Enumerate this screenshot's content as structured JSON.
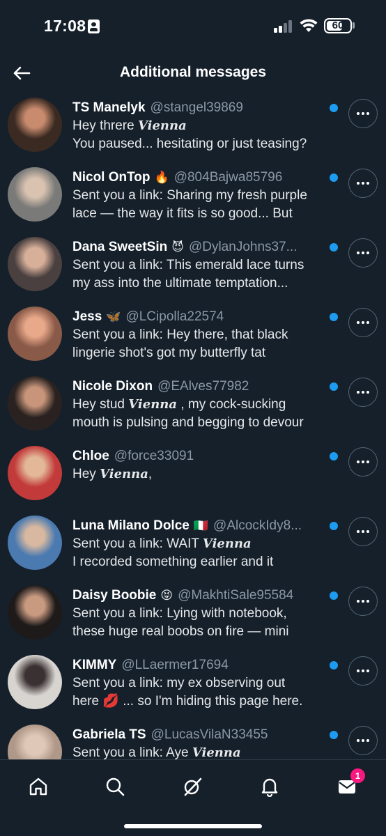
{
  "status_bar": {
    "time": "17:08",
    "battery": "60"
  },
  "header": {
    "title": "Additional messages",
    "back_icon": "arrow-left-icon"
  },
  "messages": [
    {
      "name": "TS Manelyk",
      "emoji": "",
      "handle": "@stangel39869",
      "line1_pre": "Hey threre ",
      "line1_bold": "Vienna",
      "line1_post": "",
      "line2": "You paused... hesitating or just teasing?",
      "avatar_colors": [
        "#3a2a22",
        "#c98b6e"
      ]
    },
    {
      "name": "Nicol OnTop",
      "emoji": "🔥",
      "handle": "@804Bajwa85796",
      "line1_pre": "Sent you a link: Sharing my fresh purple",
      "line1_bold": "",
      "line1_post": "",
      "line2": "lace — the way it fits is so good... But",
      "avatar_colors": [
        "#7a7a78",
        "#d9c2b0"
      ]
    },
    {
      "name": "Dana SweetSin",
      "emoji": "😈",
      "handle": "@DylanJohns37...",
      "line1_pre": "Sent you a link: This emerald lace turns",
      "line1_bold": "",
      "line1_post": "",
      "line2": "my ass into the ultimate temptation...",
      "avatar_colors": [
        "#4a4040",
        "#d8b09a"
      ]
    },
    {
      "name": "Jess",
      "emoji": "🦋",
      "handle": "@LCipolla22574",
      "line1_pre": "Sent you a link: Hey there, that black",
      "line1_bold": "",
      "line1_post": "",
      "line2": "lingerie shot's got my butterfly tat",
      "avatar_colors": [
        "#8a5a48",
        "#e8a88a"
      ]
    },
    {
      "name": "Nicole Dixon",
      "emoji": "",
      "handle": "@EAlves77982",
      "line1_pre": "Hey stud ",
      "line1_bold": "Vienna",
      "line1_post": " , my cock-sucking",
      "line2": "mouth is pulsing and begging to devour",
      "avatar_colors": [
        "#2a2220",
        "#c8957a"
      ]
    },
    {
      "name": "Chloe",
      "emoji": "",
      "handle": "@force33091",
      "line1_pre": "Hey ",
      "line1_bold": "Vienna",
      "line1_post": ",",
      "line2": "",
      "avatar_colors": [
        "#c23a3a",
        "#e2b898"
      ]
    },
    {
      "name": "Luna Milano Dolce",
      "emoji": "🇮🇹",
      "handle": "@AlcockIdy8...",
      "line1_pre": "Sent you a link: WAIT ",
      "line1_bold": "Vienna",
      "line1_post": "",
      "line2": "I recorded something earlier and it",
      "avatar_colors": [
        "#4a7ab0",
        "#d8b8a0"
      ]
    },
    {
      "name": "Daisy Boobie",
      "emoji": "😝",
      "handle": "@MakhtiSale95584",
      "line1_pre": "Sent you a link: Lying with notebook,",
      "line1_bold": "",
      "line1_post": "",
      "line2": "these huge real boobs on fire — mini",
      "avatar_colors": [
        "#1e1a1a",
        "#c89a80"
      ]
    },
    {
      "name": "KIMMY",
      "emoji": "",
      "handle": "@LLaermer17694",
      "line1_pre": "Sent you a link: my ex observing out",
      "line1_bold": "",
      "line1_post": "",
      "line2": "here 💋 ... so I'm hiding this page here.",
      "avatar_colors": [
        "#d8d4d0",
        "#3a3232"
      ]
    },
    {
      "name": "Gabriela TS",
      "emoji": "",
      "handle": "@LucasVilaN33455",
      "line1_pre": "Sent you a link: Aye ",
      "line1_bold": "Vienna",
      "line1_post": "",
      "line2": "",
      "avatar_colors": [
        "#b09888",
        "#e0c8b8"
      ]
    }
  ],
  "tabbar": {
    "items": [
      "home-icon",
      "search-icon",
      "grok-icon",
      "notifications-icon",
      "messages-icon"
    ],
    "messages_badge": "1"
  },
  "colors": {
    "background": "#15202b",
    "accent": "#1d9bf0",
    "badge": "#f91880",
    "secondary_text": "#8b98a5"
  }
}
